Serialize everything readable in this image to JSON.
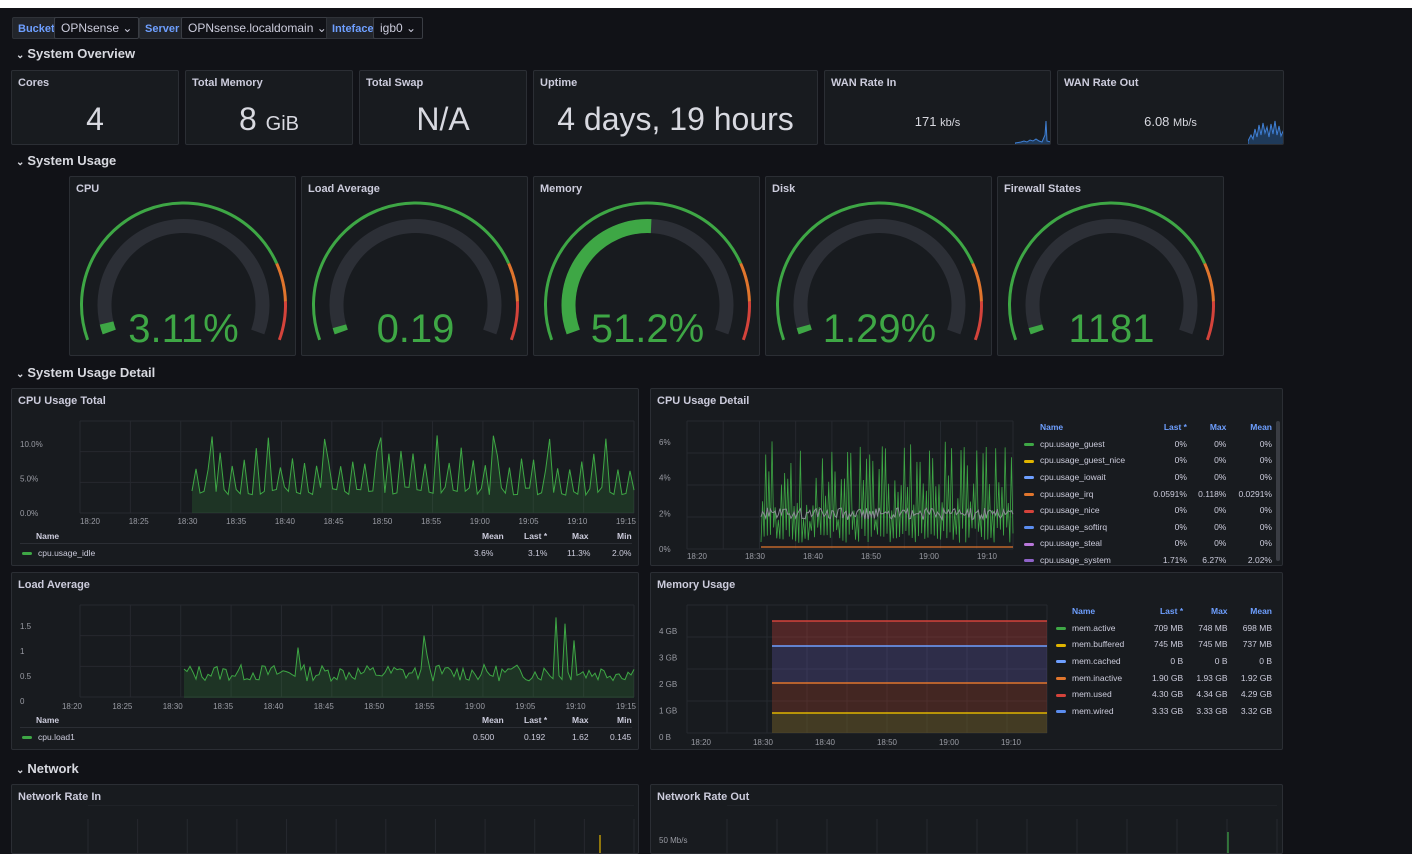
{
  "variables": [
    {
      "label": "Bucket",
      "value": "OPNsense"
    },
    {
      "label": "Server",
      "value": "OPNsense.localdomain"
    },
    {
      "label": "Inteface",
      "value": "igb0"
    }
  ],
  "rows": {
    "overview": "System Overview",
    "usage": "System Usage",
    "detail": "System Usage Detail",
    "network": "Network"
  },
  "stats": {
    "cores": {
      "title": "Cores",
      "value": "4"
    },
    "memory": {
      "title": "Total Memory",
      "value": "8",
      "unit": "GiB"
    },
    "swap": {
      "title": "Total Swap",
      "value": "N/A"
    },
    "uptime": {
      "title": "Uptime",
      "value": "4 days, 19 hours"
    },
    "wan_in": {
      "title": "WAN Rate In",
      "value": "171",
      "unit": "kb/s"
    },
    "wan_out": {
      "title": "WAN Rate Out",
      "value": "6.08",
      "unit": "Mb/s"
    }
  },
  "gauges": [
    {
      "title": "CPU",
      "display": "3.11%",
      "fraction": 0.031
    },
    {
      "title": "Load Average",
      "display": "0.19",
      "fraction": 0.019
    },
    {
      "title": "Memory",
      "display": "51.2%",
      "fraction": 0.512
    },
    {
      "title": "Disk",
      "display": "1.29%",
      "fraction": 0.013
    },
    {
      "title": "Firewall States",
      "display": "1181",
      "fraction": 0.02
    }
  ],
  "colors": {
    "green": "#3ea745",
    "orange": "#e0752d",
    "red": "#d4433b",
    "blue": "#6e9fff",
    "yellow": "#e0b400",
    "purple": "#b877d9",
    "bg": "#111217",
    "panel": "#181b1f"
  },
  "cpu_total": {
    "title": "CPU Usage Total",
    "y_ticks": [
      "10.0%",
      "5.0%",
      "0.0%"
    ],
    "x_ticks": [
      "18:20",
      "18:25",
      "18:30",
      "18:35",
      "18:40",
      "18:45",
      "18:50",
      "18:55",
      "19:00",
      "19:05",
      "19:10",
      "19:15"
    ],
    "legend_headers": {
      "name": "Name",
      "mean": "Mean",
      "last": "Last *",
      "max": "Max",
      "min": "Min"
    },
    "series": [
      {
        "name": "cpu.usage_idle",
        "mean": "3.6%",
        "last": "3.1%",
        "max": "11.3%",
        "min": "2.0%"
      }
    ]
  },
  "cpu_detail": {
    "title": "CPU Usage Detail",
    "y_ticks": [
      "6%",
      "4%",
      "2%",
      "0%"
    ],
    "x_ticks": [
      "18:20",
      "18:30",
      "18:40",
      "18:50",
      "19:00",
      "19:10"
    ],
    "legend_headers": {
      "name": "Name",
      "last": "Last *",
      "max": "Max",
      "mean": "Mean"
    },
    "series": [
      {
        "name": "cpu.usage_guest",
        "color": "#3ea745",
        "last": "0%",
        "max": "0%",
        "mean": "0%"
      },
      {
        "name": "cpu.usage_guest_nice",
        "color": "#e0b400",
        "last": "0%",
        "max": "0%",
        "mean": "0%"
      },
      {
        "name": "cpu.usage_iowait",
        "color": "#6e9fff",
        "last": "0%",
        "max": "0%",
        "mean": "0%"
      },
      {
        "name": "cpu.usage_irq",
        "color": "#e0752d",
        "last": "0.0591%",
        "max": "0.118%",
        "mean": "0.0291%"
      },
      {
        "name": "cpu.usage_nice",
        "color": "#d4433b",
        "last": "0%",
        "max": "0%",
        "mean": "0%"
      },
      {
        "name": "cpu.usage_softirq",
        "color": "#5b8def",
        "last": "0%",
        "max": "0%",
        "mean": "0%"
      },
      {
        "name": "cpu.usage_steal",
        "color": "#b877d9",
        "last": "0%",
        "max": "0%",
        "mean": "0%"
      },
      {
        "name": "cpu.usage_system",
        "color": "#8f63c9",
        "last": "1.71%",
        "max": "6.27%",
        "mean": "2.02%"
      }
    ]
  },
  "load": {
    "title": "Load Average",
    "y_ticks": [
      "1.5",
      "1",
      "0.5",
      "0"
    ],
    "x_ticks": [
      "18:20",
      "18:25",
      "18:30",
      "18:35",
      "18:40",
      "18:45",
      "18:50",
      "18:55",
      "19:00",
      "19:05",
      "19:10",
      "19:15"
    ],
    "legend_headers": {
      "name": "Name",
      "mean": "Mean",
      "last": "Last *",
      "max": "Max",
      "min": "Min"
    },
    "series": [
      {
        "name": "cpu.load1",
        "mean": "0.500",
        "last": "0.192",
        "max": "1.62",
        "min": "0.145"
      }
    ]
  },
  "memory_usage": {
    "title": "Memory Usage",
    "y_ticks": [
      "4 GB",
      "3 GB",
      "2 GB",
      "1 GB",
      "0 B"
    ],
    "x_ticks": [
      "18:20",
      "18:30",
      "18:40",
      "18:50",
      "19:00",
      "19:10"
    ],
    "legend_headers": {
      "name": "Name",
      "last": "Last *",
      "max": "Max",
      "mean": "Mean"
    },
    "series": [
      {
        "name": "mem.active",
        "color": "#3ea745",
        "last": "709 MB",
        "max": "748 MB",
        "mean": "698 MB"
      },
      {
        "name": "mem.buffered",
        "color": "#e0b400",
        "last": "745 MB",
        "max": "745 MB",
        "mean": "737 MB"
      },
      {
        "name": "mem.cached",
        "color": "#6e9fff",
        "last": "0 B",
        "max": "0 B",
        "mean": "0 B"
      },
      {
        "name": "mem.inactive",
        "color": "#e0752d",
        "last": "1.90 GB",
        "max": "1.93 GB",
        "mean": "1.92 GB"
      },
      {
        "name": "mem.used",
        "color": "#d4433b",
        "last": "4.30 GB",
        "max": "4.34 GB",
        "mean": "4.29 GB"
      },
      {
        "name": "mem.wired",
        "color": "#5b8def",
        "last": "3.33 GB",
        "max": "3.33 GB",
        "mean": "3.32 GB"
      }
    ]
  },
  "net_in": {
    "title": "Network Rate In"
  },
  "net_out": {
    "title": "Network Rate Out",
    "y_tick": "50 Mb/s"
  }
}
